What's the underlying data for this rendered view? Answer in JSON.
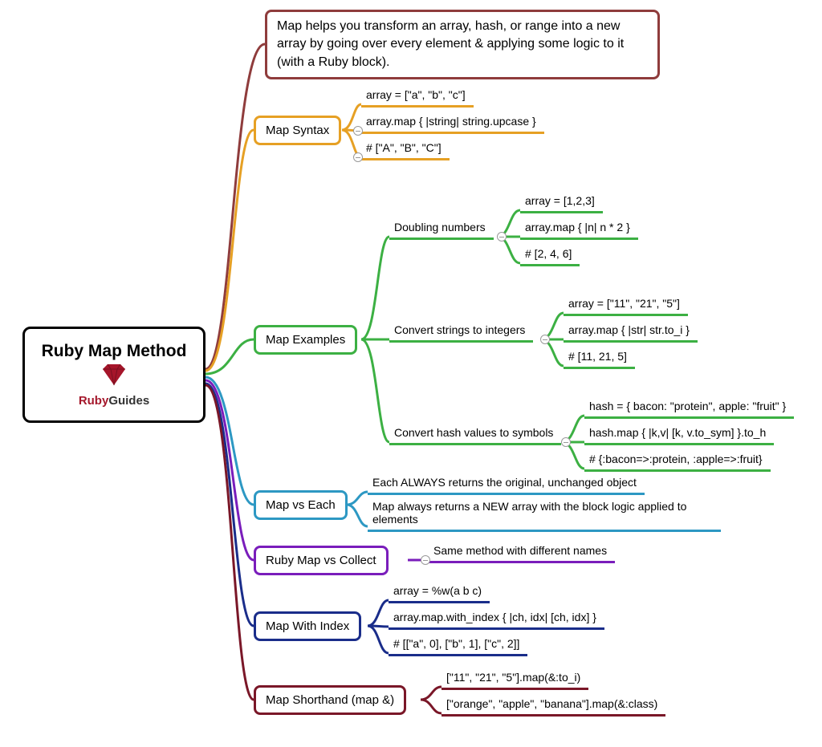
{
  "root": {
    "title": "Ruby Map Method",
    "logo_text_1": "Ruby",
    "logo_text_2": "Guides"
  },
  "description": "Map helps you transform an array, hash, or range into a new array by going over every element & applying some logic to it (with a Ruby block).",
  "branches": {
    "syntax": {
      "label": "Map Syntax",
      "lines": [
        "array = [\"a\", \"b\", \"c\"]",
        "array.map { |string| string.upcase }",
        "# [\"A\", \"B\", \"C\"]"
      ]
    },
    "examples": {
      "label": "Map Examples",
      "sub": [
        {
          "label": "Doubling numbers",
          "lines": [
            "array = [1,2,3]",
            "array.map { |n| n * 2 }",
            "# [2, 4, 6]"
          ]
        },
        {
          "label": "Convert strings to integers",
          "lines": [
            "array = [\"11\", \"21\", \"5\"]",
            "array.map { |str| str.to_i }",
            "# [11, 21, 5]"
          ]
        },
        {
          "label": "Convert hash values to symbols",
          "lines": [
            "hash = { bacon: \"protein\", apple: \"fruit\" }",
            "hash.map { |k,v| [k, v.to_sym] }.to_h",
            "# {:bacon=>:protein, :apple=>:fruit}"
          ]
        }
      ]
    },
    "vs_each": {
      "label": "Map vs Each",
      "lines": [
        "Each ALWAYS returns the original, unchanged object",
        "Map always returns a NEW array with the block logic applied to elements"
      ]
    },
    "vs_collect": {
      "label": "Ruby Map vs Collect",
      "lines": [
        "Same method with different names"
      ]
    },
    "with_index": {
      "label": "Map With Index",
      "lines": [
        "array = %w(a b c)",
        "array.map.with_index { |ch, idx| [ch, idx] }",
        "# [[\"a\", 0], [\"b\", 1], [\"c\", 2]]"
      ]
    },
    "shorthand": {
      "label": "Map Shorthand (map &)",
      "lines": [
        "[\"11\", \"21\", \"5\"].map(&:to_i)",
        "[\"orange\", \"apple\", \"banana\"].map(&:class)"
      ]
    }
  }
}
